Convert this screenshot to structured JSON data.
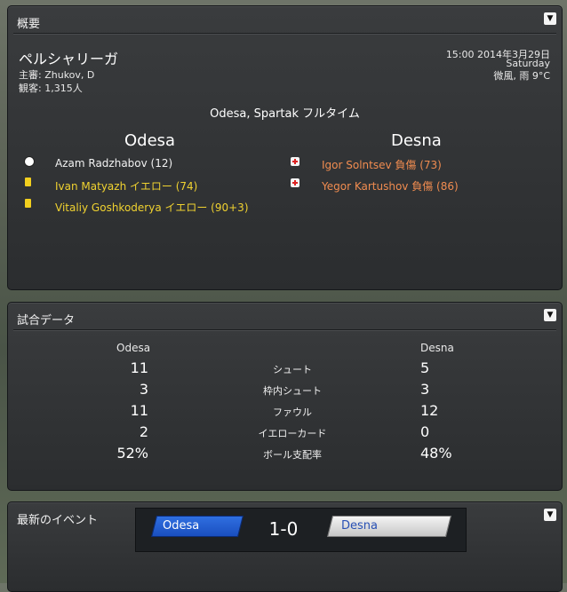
{
  "overview": {
    "title": "概要",
    "competition": "ペルシャリーガ",
    "referee_label": "主審:",
    "referee": "Zhukov, D",
    "attendance_label": "観客:",
    "attendance": "1,315人",
    "datetime": "15:00 2014年3月29日",
    "weekday": "Saturday",
    "weather": "微風, 雨 9°C",
    "venue": "Odesa, Spartak フルタイム",
    "home_team": "Odesa",
    "away_team": "Desna",
    "home_events": [
      {
        "type": "goal",
        "text": "Azam Radzhabov (12)"
      },
      {
        "type": "yellow-card",
        "text": "Ivan Matyazh イエロー (74)"
      },
      {
        "type": "yellow-card",
        "text": "Vitaliy Goshkoderya イエロー (90+3)"
      }
    ],
    "away_events": [
      {
        "type": "injury",
        "text": "Igor Solntsev 負傷 (73)"
      },
      {
        "type": "injury",
        "text": "Yegor Kartushov 負傷 (86)"
      }
    ]
  },
  "stats": {
    "title": "試合データ",
    "home": "Odesa",
    "away": "Desna",
    "rows": [
      {
        "label": "シュート",
        "home": "11",
        "away": "5"
      },
      {
        "label": "枠内シュート",
        "home": "3",
        "away": "3"
      },
      {
        "label": "ファウル",
        "home": "11",
        "away": "12"
      },
      {
        "label": "イエローカード",
        "home": "2",
        "away": "0"
      },
      {
        "label": "ボール支配率",
        "home": "52%",
        "away": "48%"
      }
    ]
  },
  "latest": {
    "title": "最新のイベント",
    "home": "Odesa",
    "away": "Desna",
    "score": "1-0"
  },
  "colors": {
    "yellow_text": "#f0d230",
    "orange_text": "#f08c50",
    "home_badge": "#1a4fc0",
    "away_badge": "#c6c6c6",
    "away_badge_text": "#2850b4"
  }
}
